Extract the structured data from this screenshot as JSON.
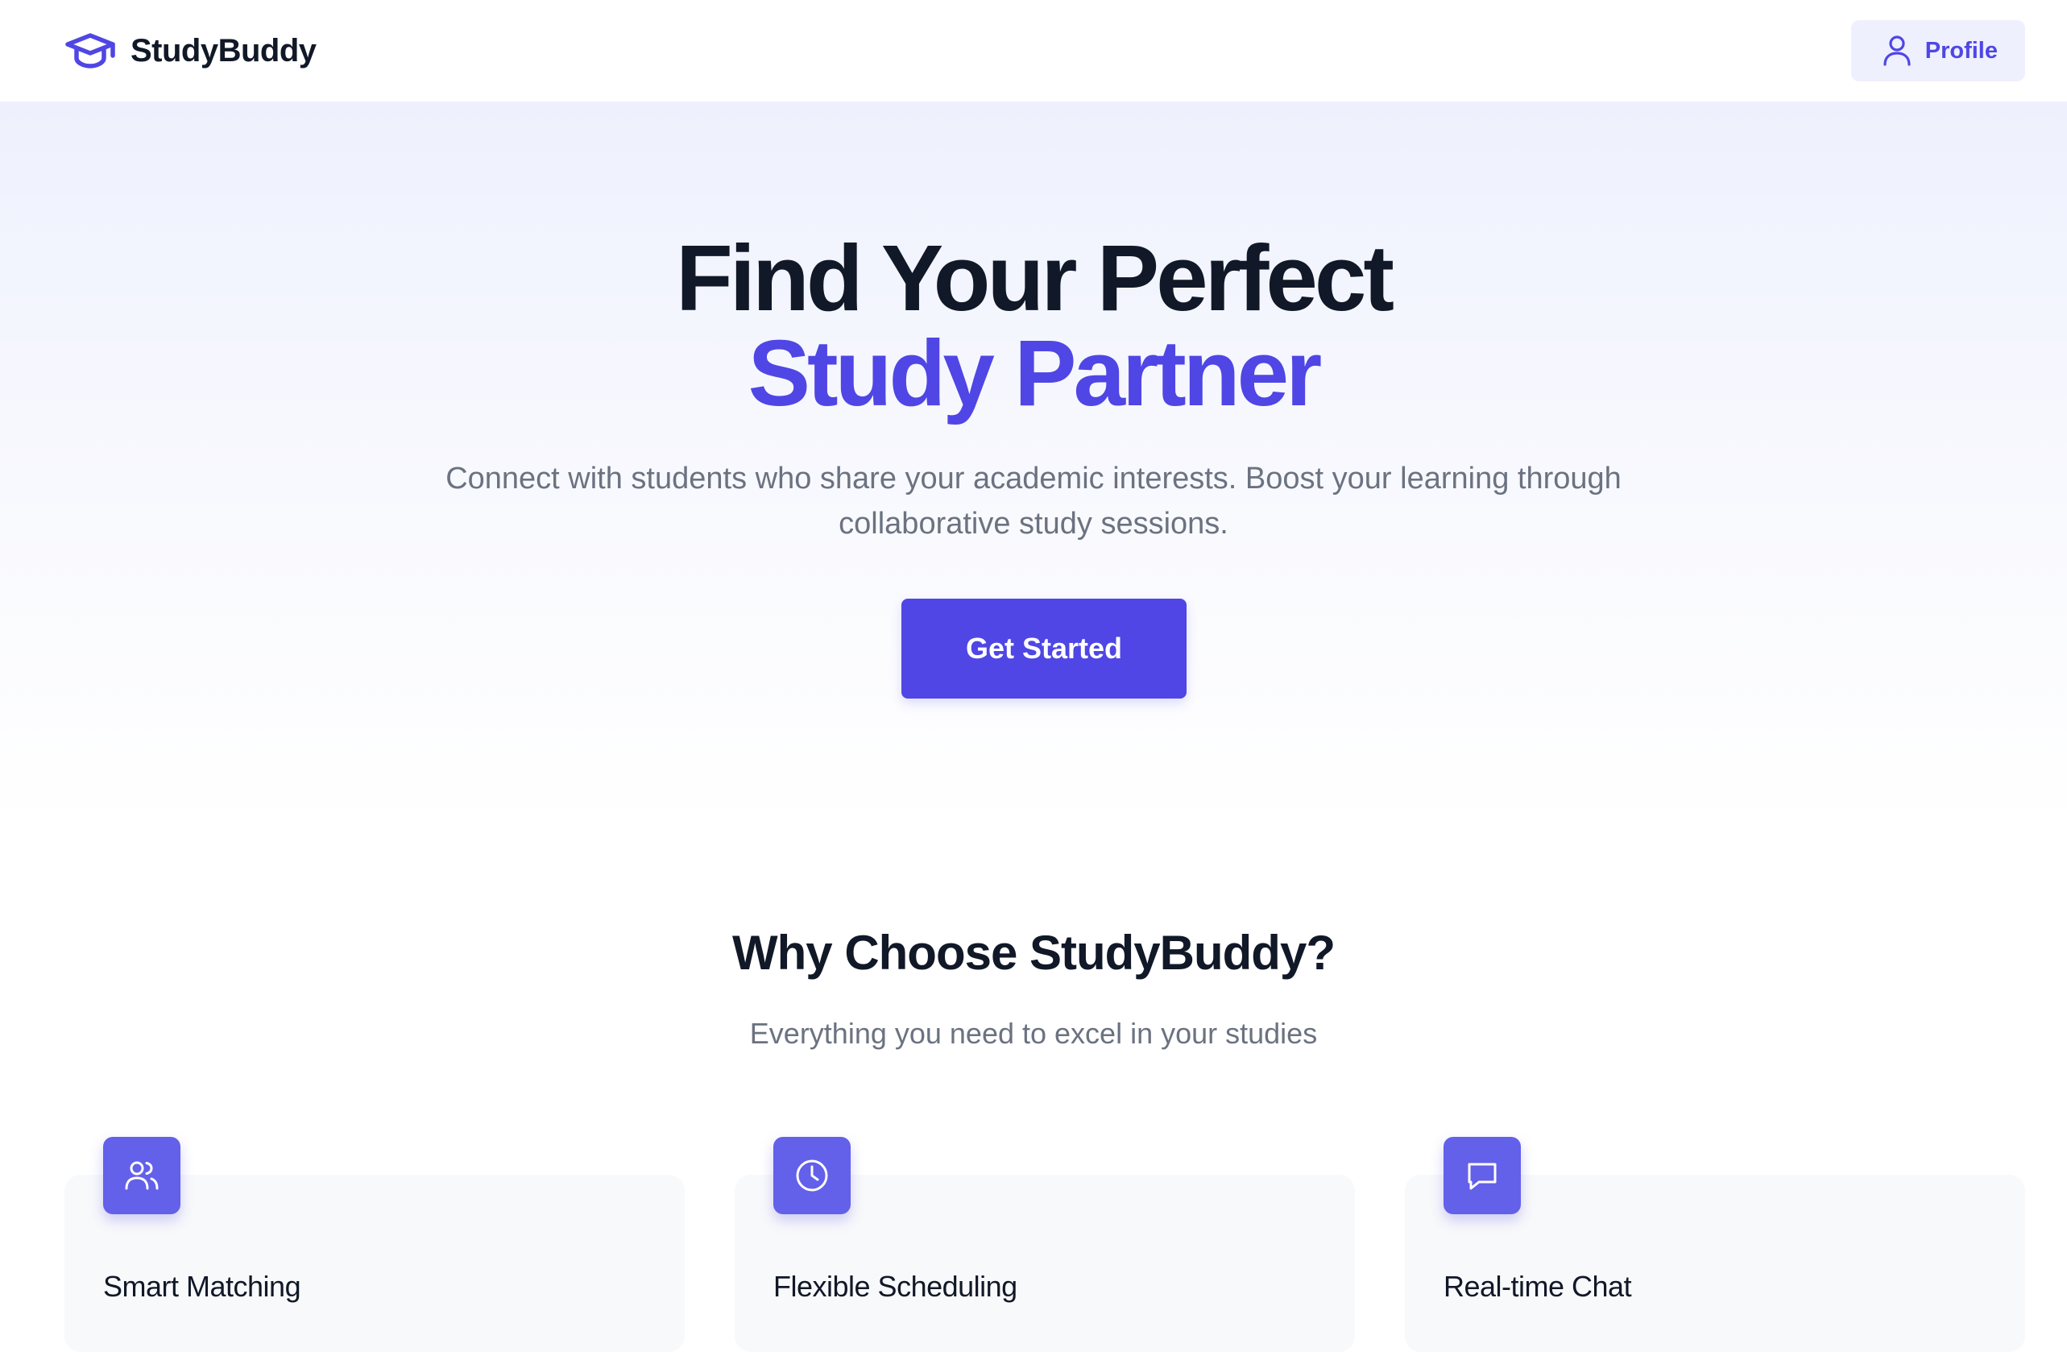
{
  "header": {
    "brand_name": "StudyBuddy",
    "brand_icon": "graduation-cap-icon",
    "profile_label": "Profile",
    "profile_icon": "user-icon"
  },
  "hero": {
    "title_line1": "Find Your Perfect",
    "title_line2": "Study Partner",
    "subtitle": "Connect with students who share your academic interests. Boost your learning through collaborative study sessions.",
    "cta_label": "Get Started"
  },
  "features": {
    "title": "Why Choose StudyBuddy?",
    "subtitle": "Everything you need to excel in your studies",
    "cards": [
      {
        "icon": "users-icon",
        "title": "Smart Matching"
      },
      {
        "icon": "clock-icon",
        "title": "Flexible Scheduling"
      },
      {
        "icon": "chat-icon",
        "title": "Real-time Chat"
      }
    ]
  },
  "colors": {
    "accent": "#4f46e5",
    "card_icon_bg": "#6360ea",
    "text_dark": "#111827",
    "text_muted": "#6b7280",
    "profile_bg": "#eef0fd"
  }
}
